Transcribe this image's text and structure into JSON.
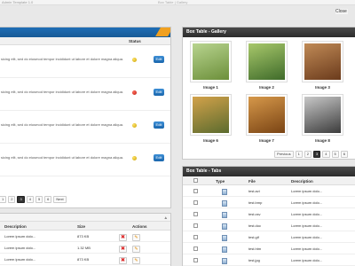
{
  "window": {
    "title": "Admin Template 1.0",
    "center_title": "Box Table | Gallery",
    "close_label": "Close"
  },
  "left_panel": {
    "status_header": "Status",
    "rows": [
      {
        "text": "sicing elit, sed do eiusmod tempor incididunt ut labore et dolore magna aliqua.",
        "status": "yellow",
        "btn": "Edit"
      },
      {
        "text": "sicing elit, sed do eiusmod tempor incididunt ut labore et dolore magna aliqua.",
        "status": "red",
        "btn": "Edit"
      },
      {
        "text": "sicing elit, sed do eiusmod tempor incididunt ut labore et dolore magna aliqua.",
        "status": "yellow",
        "btn": "Edit"
      },
      {
        "text": "sicing elit, sed do eiusmod tempor incididunt ut labore et dolore magna aliqua.",
        "status": "yellow",
        "btn": "Edit"
      }
    ],
    "pager": [
      "1",
      "2",
      "3",
      "4",
      "5",
      "6",
      "Next"
    ],
    "active_page": "3"
  },
  "left_bottom": {
    "headers": {
      "description": "Description",
      "size": "Size",
      "actions": "Actions"
    },
    "rows": [
      {
        "desc": "Lorem ipsum dolo...",
        "size": "873 KB"
      },
      {
        "desc": "Lorem ipsum dolo...",
        "size": "1.32 MB"
      },
      {
        "desc": "Lorem ipsum dolo...",
        "size": "873 KB"
      }
    ]
  },
  "gallery": {
    "title": "Box Table - Gallery",
    "images": [
      {
        "label": "Image 1",
        "colors": [
          "#b8d48f",
          "#6c8f3a"
        ]
      },
      {
        "label": "Image 2",
        "colors": [
          "#a8c86b",
          "#3f6b2a"
        ]
      },
      {
        "label": "Image 3",
        "colors": [
          "#c08a56",
          "#6b3b1c"
        ]
      },
      {
        "label": "Image 6",
        "colors": [
          "#d3a24a",
          "#5b6b2e"
        ]
      },
      {
        "label": "Image 7",
        "colors": [
          "#d6984a",
          "#7a4414"
        ]
      },
      {
        "label": "Image 8",
        "colors": [
          "#c8c8c8",
          "#3c3c3c"
        ]
      }
    ],
    "pager": [
      "Previous",
      "1",
      "2",
      "3",
      "4",
      "5",
      "6"
    ],
    "active_page": "3"
  },
  "tabs_panel": {
    "title": "Box Table - Tabs",
    "headers": {
      "type": "Type",
      "file": "File",
      "description": "Description"
    },
    "rows": [
      {
        "file": "test.avi",
        "desc": "Lorem ipsum dolo..."
      },
      {
        "file": "test.bmp",
        "desc": "Lorem ipsum dolo..."
      },
      {
        "file": "test.csv",
        "desc": "Lorem ipsum dolo..."
      },
      {
        "file": "test.doc",
        "desc": "Lorem ipsum dolo..."
      },
      {
        "file": "test.gif",
        "desc": "Lorem ipsum dolo..."
      },
      {
        "file": "test.htm",
        "desc": "Lorem ipsum dolo..."
      },
      {
        "file": "test.jpg",
        "desc": "Lorem ipsum dolo..."
      }
    ]
  },
  "colors": {
    "accent_blue": "#1f6fb6",
    "ribbon": "#f0a020",
    "header_dark": "#2c2c2c"
  }
}
